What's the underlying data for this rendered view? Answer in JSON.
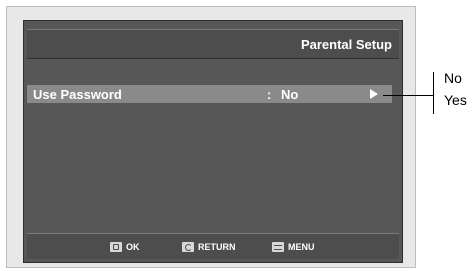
{
  "screen": {
    "title": "Parental Setup",
    "row": {
      "label": "Use Password",
      "colon": ":",
      "value": "No",
      "arrow_icon": "right-arrow-icon"
    },
    "footer": {
      "ok": {
        "label": "OK",
        "icon": "enter-icon"
      },
      "return": {
        "label": "RETURN",
        "icon": "return-icon"
      },
      "menu": {
        "label": "MENU",
        "icon": "menu-icon"
      }
    }
  },
  "callout": {
    "options": [
      "No",
      "Yes"
    ]
  },
  "colors": {
    "screen_bg": "#575757",
    "highlight": "#8a8a8a",
    "text": "#ffffff"
  }
}
